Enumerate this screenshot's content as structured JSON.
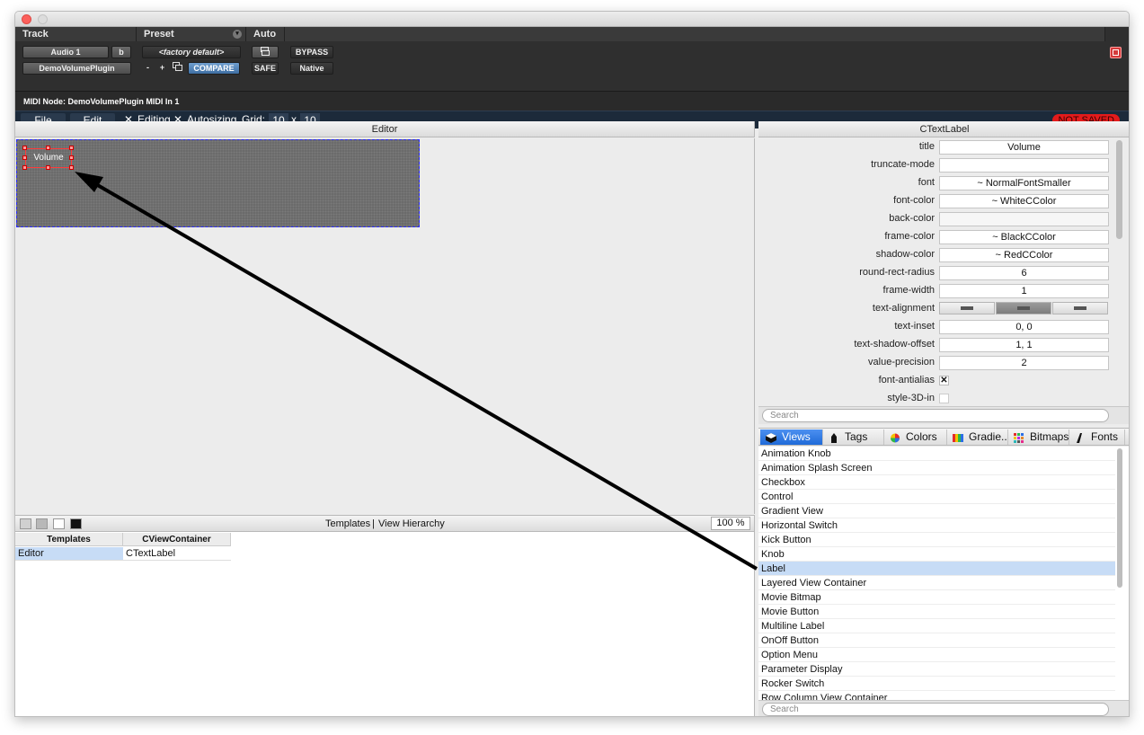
{
  "header": {
    "track_label": "Track",
    "preset_label": "Preset",
    "auto_label": "Auto",
    "track_name": "Audio 1",
    "track_channel": "b",
    "plugin_name": "DemoVolumePlugin",
    "preset_value": "<factory default>",
    "preset_minus": "-",
    "preset_plus": "+",
    "compare_label": "COMPARE",
    "bypass_label": "BYPASS",
    "safe_label": "SAFE",
    "native_label": "Native"
  },
  "midi_node": "MIDI Node: DemoVolumePlugin MIDI In 1",
  "menubar": {
    "file": "File",
    "edit": "Edit",
    "editing": "Editing",
    "autosizing": "Autosizing",
    "grid_label": "Grid:",
    "grid_x": "10",
    "grid_times": "x",
    "grid_y": "10",
    "not_saved": "NOT SAVED"
  },
  "editor": {
    "title": "Editor",
    "label_text": "Volume"
  },
  "templates": {
    "bar_title_a": "Templates",
    "bar_sep": "|",
    "bar_title_b": "View Hierarchy",
    "zoom": "100 %",
    "col_templates": "Templates",
    "col_container": "CViewContainer",
    "row_template": "Editor",
    "row_view": "CTextLabel"
  },
  "attributes": {
    "title": "CTextLabel",
    "rows": [
      {
        "label": "title",
        "value": "Volume"
      },
      {
        "label": "truncate-mode",
        "value": ""
      },
      {
        "label": "font",
        "value": "~ NormalFontSmaller"
      },
      {
        "label": "font-color",
        "value": "~ WhiteCColor"
      },
      {
        "label": "back-color",
        "value": ""
      },
      {
        "label": "frame-color",
        "value": "~ BlackCColor"
      },
      {
        "label": "shadow-color",
        "value": "~ RedCColor"
      },
      {
        "label": "round-rect-radius",
        "value": "6"
      },
      {
        "label": "frame-width",
        "value": "1"
      },
      {
        "label": "text-alignment",
        "value": ""
      },
      {
        "label": "text-inset",
        "value": "0, 0"
      },
      {
        "label": "text-shadow-offset",
        "value": "1, 1"
      },
      {
        "label": "value-precision",
        "value": "2"
      },
      {
        "label": "font-antialias",
        "value": "✕"
      },
      {
        "label": "style-3D-in",
        "value": ""
      }
    ],
    "frame_color_swatch": "#000000",
    "shadow_color_swatch": "#ff0000",
    "search_placeholder": "Search"
  },
  "tabs": [
    {
      "label": "Views",
      "icon": "cube-icon"
    },
    {
      "label": "Tags",
      "icon": "tag-icon"
    },
    {
      "label": "Colors",
      "icon": "color-wheel-icon"
    },
    {
      "label": "Gradie..",
      "icon": "gradient-icon"
    },
    {
      "label": "Bitmaps",
      "icon": "bitmaps-icon"
    },
    {
      "label": "Fonts",
      "icon": "font-icon"
    }
  ],
  "views": [
    "Animation Knob",
    "Animation Splash Screen",
    "Checkbox",
    "Control",
    "Gradient View",
    "Horizontal Switch",
    "Kick Button",
    "Knob",
    "Label",
    "Layered View Container",
    "Movie Bitmap",
    "Movie Button",
    "Multiline Label",
    "OnOff Button",
    "Option Menu",
    "Parameter Display",
    "Rocker Switch",
    "Row Column View Container"
  ],
  "selected_view": "Label",
  "views_search_placeholder": "Search",
  "colors": {
    "accent": "#1f6ad8",
    "not_saved": "#e31b1b",
    "selection": "#c7dcf6"
  }
}
